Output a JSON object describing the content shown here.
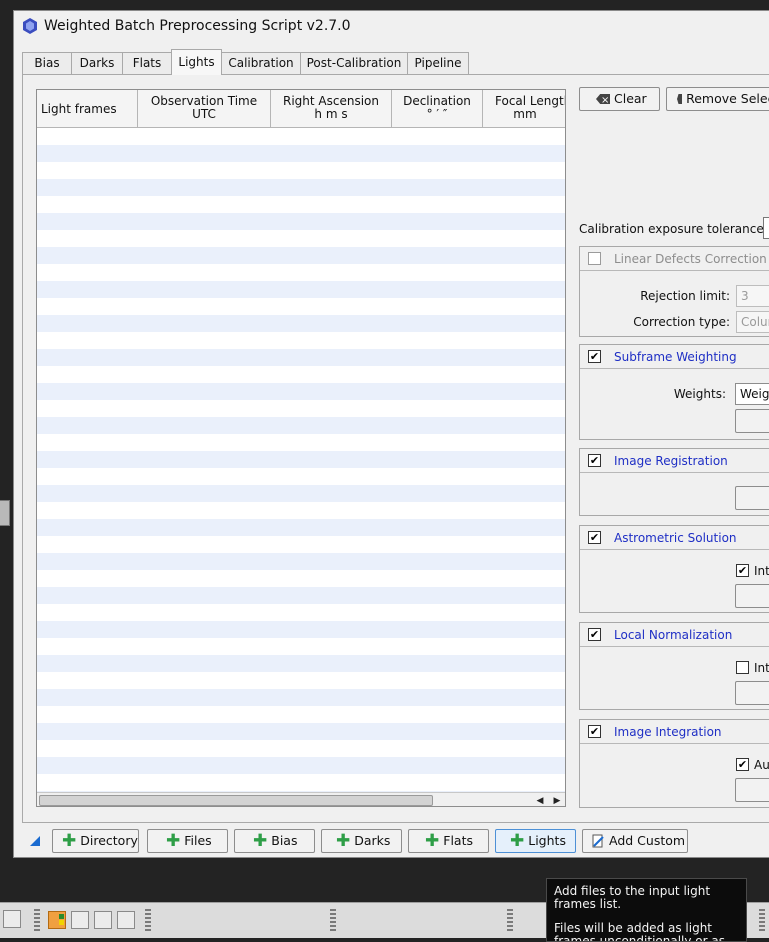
{
  "window": {
    "title": "Weighted Batch Preprocessing Script v2.7.0"
  },
  "tabs": [
    "Bias",
    "Darks",
    "Flats",
    "Lights",
    "Calibration",
    "Post-Calibration",
    "Pipeline"
  ],
  "active_tab": "Lights",
  "table": {
    "columns": [
      {
        "line1": "Light frames",
        "line2": ""
      },
      {
        "line1": "Observation Time",
        "line2": "UTC"
      },
      {
        "line1": "Right Ascension",
        "line2": "h  m  s"
      },
      {
        "line1": "Declination",
        "line2": "°  ′  ″"
      },
      {
        "line1": "Focal Length",
        "line2": "mm"
      }
    ],
    "rows": []
  },
  "top_buttons": {
    "clear": "Clear",
    "remove_selected": "Remove Selected"
  },
  "calibration_tolerance": {
    "label": "Calibration exposure tolerance:"
  },
  "groups": {
    "linear_defects": {
      "title": "Linear Defects Correction",
      "checked": false,
      "enabled": false,
      "rejection_label": "Rejection limit:",
      "rejection_value": "3",
      "correction_label": "Correction type:",
      "correction_value": "Columns"
    },
    "subframe_weighting": {
      "title": "Subframe Weighting",
      "checked": true,
      "weights_label": "Weights:",
      "weights_value": "Weighting formula"
    },
    "image_registration": {
      "title": "Image Registration",
      "checked": true
    },
    "astrometric_solution": {
      "title": "Astrometric Solution",
      "checked": true,
      "option_label": "Interactive",
      "option_checked": true
    },
    "local_normalization": {
      "title": "Local Normalization",
      "checked": true,
      "option_label": "Interactive",
      "option_checked": false
    },
    "image_integration": {
      "title": "Image Integration",
      "checked": true,
      "option_label": "Automatic",
      "option_checked": true
    }
  },
  "bottom_buttons": [
    "Directory",
    "Files",
    "Bias",
    "Darks",
    "Flats",
    "Lights"
  ],
  "add_custom": "Add Custom",
  "tooltip": {
    "line1": "Add files to the input light frames list.",
    "line2": "Files will be added as light frames unconditionally or as FITS"
  },
  "colors": {
    "group_title": "#1f2fc5",
    "plus_icon": "#2e9e47",
    "active_button_border": "#4d90d6"
  }
}
